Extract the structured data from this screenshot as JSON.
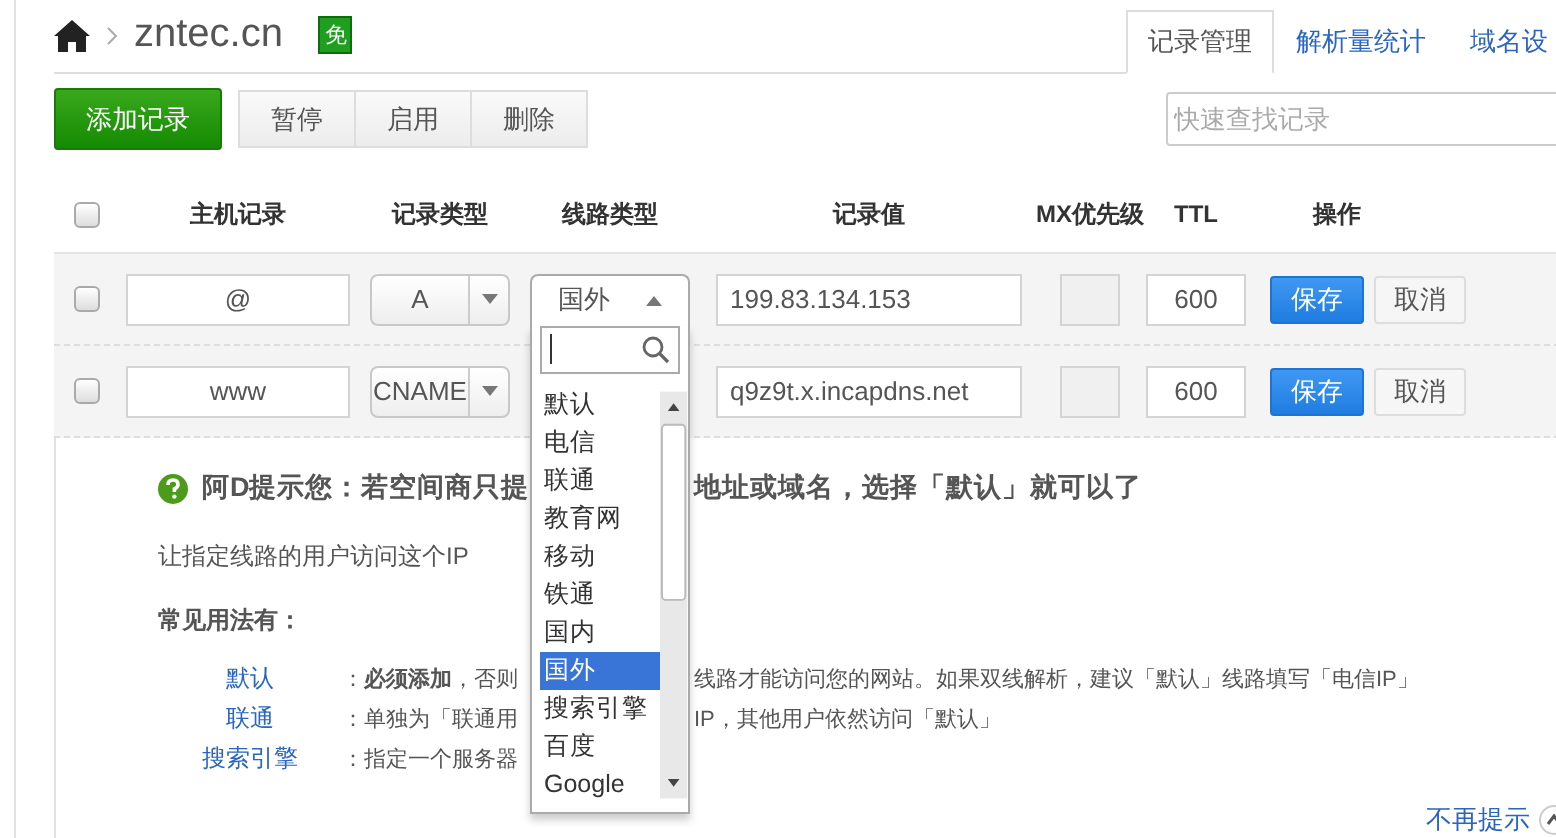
{
  "breadcrumb": {
    "domain": "zntec.cn",
    "badge": "免"
  },
  "tabs": [
    {
      "label": "记录管理",
      "selected": true
    },
    {
      "label": "解析量统计",
      "selected": false
    },
    {
      "label": "域名设",
      "selected": false
    }
  ],
  "toolbar": {
    "add_button": "添加记录",
    "buttons": [
      "暂停",
      "启用",
      "删除"
    ],
    "search": {
      "placeholder": "快速查找记录"
    }
  },
  "table": {
    "header_checked": false,
    "columns": [
      "主机记录",
      "记录类型",
      "线路类型",
      "记录值",
      "MX优先级",
      "TTL",
      "操作"
    ],
    "rows": [
      {
        "checked": false,
        "host": "@",
        "type": "A",
        "line": "国外",
        "line_expanded": true,
        "value": "199.83.134.153",
        "ttl": "600",
        "actions": [
          "保存",
          "取消"
        ],
        "line_options": [
          {
            "label": "默认",
            "selected": false
          },
          {
            "label": "电信",
            "selected": false
          },
          {
            "label": "联通",
            "selected": false
          },
          {
            "label": "教育网",
            "selected": false
          },
          {
            "label": "移动",
            "selected": false
          },
          {
            "label": "铁通",
            "selected": false
          },
          {
            "label": "国内",
            "selected": false
          },
          {
            "label": "国外",
            "selected": true
          },
          {
            "label": "搜索引擎",
            "selected": false
          },
          {
            "label": "百度",
            "selected": false
          },
          {
            "label": "Google",
            "selected": false
          }
        ]
      },
      {
        "checked": false,
        "host": "www",
        "type": "CNAME",
        "value": "q9z9t.x.incapdns.net",
        "ttl": "600",
        "actions": [
          "保存",
          "取消"
        ]
      }
    ]
  },
  "hint": {
    "title_parts": [
      "阿D提示您：若空间商只提",
      "地址或域名，选择「默认」就可以了"
    ],
    "subtitle": "让指定线路的用户访问这个IP",
    "usage_title": "常见用法有：",
    "usages": [
      {
        "label": "默认",
        "parts": [
          "：**必须添加**，否则",
          "线路才能访问您的网站。如果双线解析，建议「默认」线路填写「电信IP」"
        ]
      },
      {
        "label": "联通",
        "parts": [
          "：单独为「联通用",
          "IP，其他用户依然访问「默认」"
        ]
      },
      {
        "label": "搜索引擎",
        "parts": [
          "：指定一个服务器"
        ]
      }
    ]
  },
  "dismiss_link": "不再提示"
}
